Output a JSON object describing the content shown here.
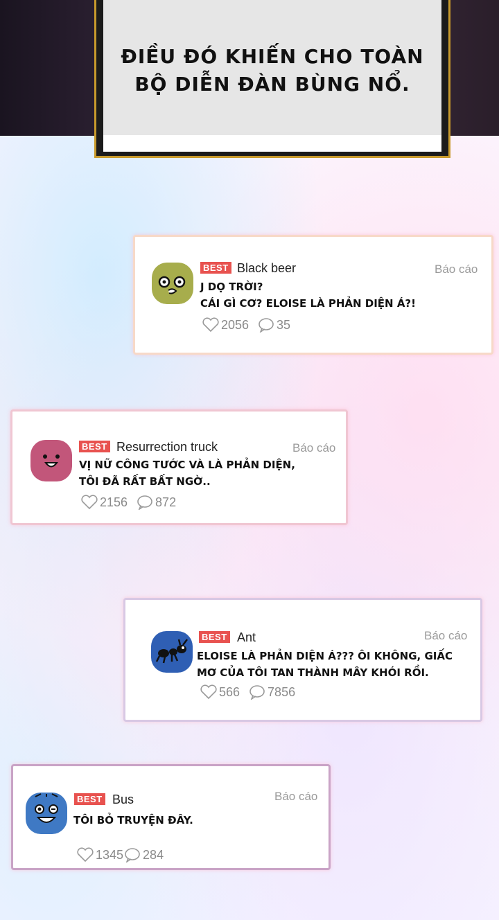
{
  "narration": {
    "line1": "ĐIỀU ĐÓ KHIẾN CHO TOÀN",
    "line2": "BỘ DIỄN ĐÀN BÙNG NỔ."
  },
  "comments": [
    {
      "badge": "BEST",
      "user": "Black beer",
      "report": "Báo cáo",
      "text": "J DỌ TRỜI?\nCÁI GÌ CƠ? ELOISE LÀ PHẢN DIỆN Á?!",
      "likes": "2056",
      "replies": "35",
      "avatar_color": "#a7ad4c"
    },
    {
      "badge": "BEST",
      "user": "Resurrection truck",
      "report": "Báo cáo",
      "text": "VỊ NỮ CÔNG TƯỚC VÀ LÀ PHẢN DIỆN,\nTÔI ĐÃ RẤT BẤT NGỜ..",
      "likes": "2156",
      "replies": "872",
      "avatar_color": "#c2567a"
    },
    {
      "badge": "BEST",
      "user": "Ant",
      "report": "Báo cáo",
      "text": "ELOISE LÀ PHẢN DIỆN Á??? ÔI KHÔNG, GIẤC\nMƠ CỦA TÔI TAN THÀNH MÂY KHÓI RỒI.",
      "likes": "566",
      "replies": "7856",
      "avatar_color": "#2f5fb4"
    },
    {
      "badge": "BEST",
      "user": "Bus",
      "report": "Báo cáo",
      "text": "TÔI BỎ TRUYỆN ĐÂY.",
      "likes": "1345",
      "replies": "284",
      "avatar_color": "#3f79c4"
    }
  ]
}
